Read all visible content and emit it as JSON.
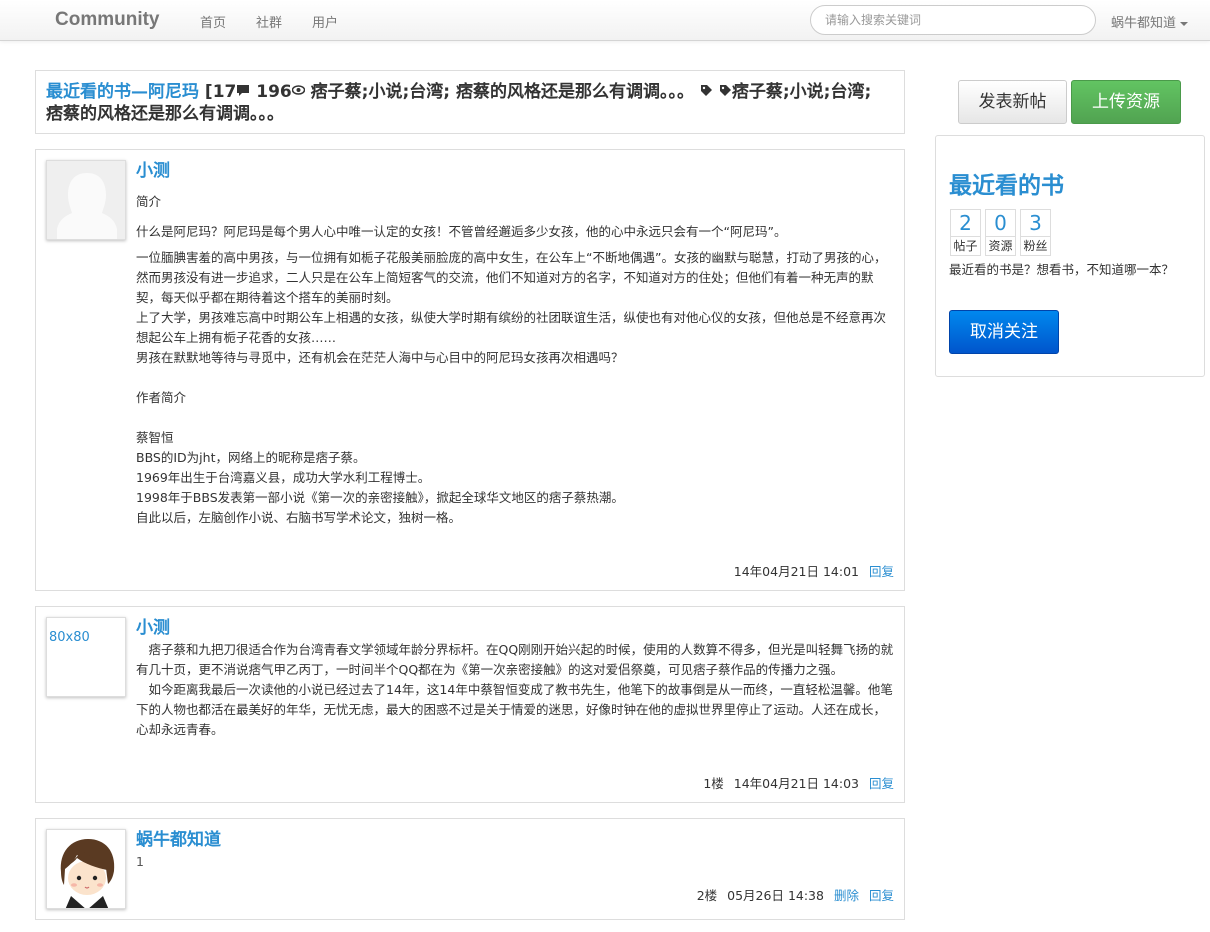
{
  "navbar": {
    "brand": "Community",
    "links": [
      "首页",
      "社群",
      "用户"
    ],
    "search_placeholder": "请输入搜索关键词",
    "user": "蜗牛都知道"
  },
  "topic": {
    "link_text": "最近看的书—阿尼玛",
    "bracket": " [17",
    "replies_icon": "comment-icon",
    "views": " 196",
    "views_icon": "eye-icon",
    "summary": " 痞子蔡;小说;台湾; 痞蔡的风格还是那么有调调。。。",
    "tag_icon": "tag-icon",
    "tags": "痞子蔡;小说;台湾; 痞蔡的风格还是那么有调调。。。"
  },
  "posts": [
    {
      "author": "小测",
      "paragraphs": [
        "简介",
        "什么是阿尼玛？阿尼玛是每个男人心中唯一认定的女孩！不管曾经邂逅多少女孩，他的心中永远只会有一个“阿尼玛”。",
        "一位腼腆害羞的高中男孩，与一位拥有如栀子花般美丽脸庞的高中女生，在公车上“不断地偶遇”。女孩的幽默与聪慧，打动了男孩的心，然而男孩没有进一步追求，二人只是在公车上简短客气的交流，他们不知道对方的名字，不知道对方的住处；但他们有着一种无声的默契，每天似乎都在期待着这个搭车的美丽时刻。",
        "上了大学，男孩难忘高中时期公车上相遇的女孩，纵使大学时期有缤纷的社团联谊生活，纵使也有对他心仪的女孩，但他总是不经意再次想起公车上拥有栀子花香的女孩……",
        "男孩在默默地等待与寻觅中，还有机会在茫茫人海中与心目中的阿尼玛女孩再次相遇吗？",
        "作者简介",
        "蔡智恒",
        "BBS的ID为jht，网络上的昵称是痞子蔡。",
        "1969年出生于台湾嘉义县，成功大学水利工程博士。",
        "1998年于BBS发表第一部小说《第一次的亲密接触》，掀起全球华文地区的痞子蔡热潮。",
        "自此以后，左脑创作小说、右脑书写学术论文，独树一格。"
      ],
      "time": "14年04月21日 14:01",
      "reply": "回复"
    },
    {
      "author": "小测",
      "avatar_text": "80x80",
      "paragraphs": [
        "　痞子蔡和九把刀很适合作为台湾青春文学领域年龄分界标杆。在QQ刚刚开始兴起的时候，使用的人数算不得多，但光是叫轻舞飞扬的就有几十页，更不消说痞气甲乙丙丁，一时间半个QQ都在为《第一次亲密接触》的这对爱侣祭奠，可见痞子蔡作品的传播力之强。",
        "　如今距离我最后一次读他的小说已经过去了14年，这14年中蔡智恒变成了教书先生，他笔下的故事倒是从一而终，一直轻松温馨。他笔下的人物也都活在最美好的年华，无忧无虑，最大的困惑不过是关于情爱的迷思，好像时钟在他的虚拟世界里停止了运动。人还在成长，心却永远青春。"
      ],
      "floor": "1楼",
      "time": "14年04月21日 14:03",
      "reply": "回复"
    },
    {
      "author": "蜗牛都知道",
      "paragraphs": [
        "1"
      ],
      "floor": "2楼",
      "time": "05月26日 14:38",
      "delete": "删除",
      "reply": "回复"
    }
  ],
  "sidebar": {
    "new_post": "发表新帖",
    "upload": "上传资源",
    "title": "最近看的书",
    "stats": [
      {
        "num": "2",
        "label": "帖子"
      },
      {
        "num": "0",
        "label": "资源"
      },
      {
        "num": "3",
        "label": "粉丝"
      }
    ],
    "description": "最近看的书是？想看书，不知道哪一本？",
    "unfollow": "取消关注"
  },
  "colors": {
    "link": "#2a8ed1",
    "success": "#51a351",
    "primary": "#0066dd"
  }
}
